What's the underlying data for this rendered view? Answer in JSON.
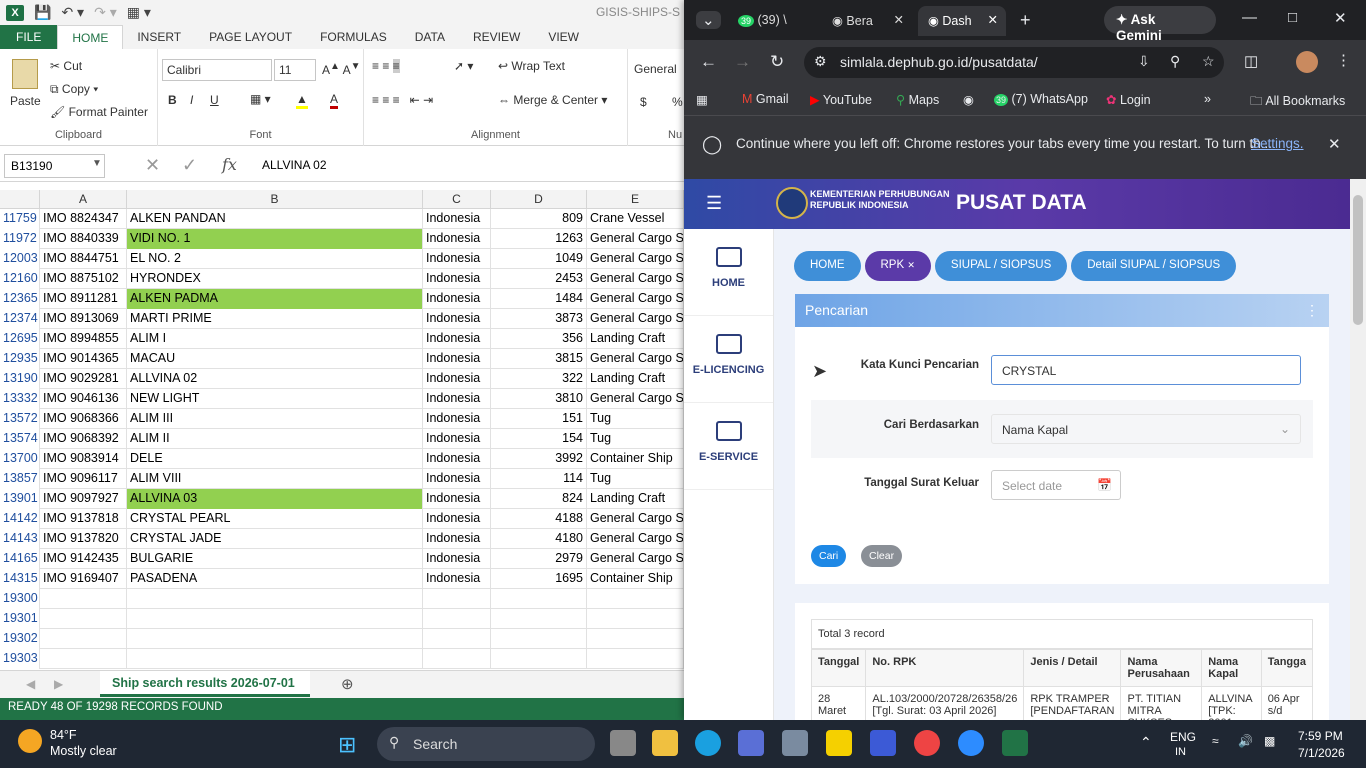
{
  "excel": {
    "doc_title": "GISIS-SHIPS-S",
    "ribbon_tabs": [
      "FILE",
      "HOME",
      "INSERT",
      "PAGE LAYOUT",
      "FORMULAS",
      "DATA",
      "REVIEW",
      "VIEW"
    ],
    "clipboard": {
      "paste": "Paste",
      "cut": "Cut",
      "copy": "Copy",
      "format_painter": "Format Painter",
      "label": "Clipboard"
    },
    "font": {
      "name": "Calibri",
      "size": "11",
      "label": "Font",
      "bold": "B",
      "italic": "I",
      "underline": "U"
    },
    "alignment": {
      "wrap": "Wrap Text",
      "merge": "Merge & Center",
      "label": "Alignment"
    },
    "number": {
      "format": "General",
      "label": "Nu",
      "currency": "$",
      "percent": "%"
    },
    "name_box": "B13190",
    "formula_value": "ALLVINA 02",
    "columns": [
      "A",
      "B",
      "C",
      "D",
      "E"
    ],
    "rows": [
      {
        "n": "11759",
        "a": "IMO 8824347",
        "b": "ALKEN PANDAN",
        "c": "Indonesia",
        "d": "809",
        "e": "Crane Vessel",
        "hl": false
      },
      {
        "n": "11972",
        "a": "IMO 8840339",
        "b": "VIDI NO. 1",
        "c": "Indonesia",
        "d": "1263",
        "e": "General Cargo S",
        "hl": true
      },
      {
        "n": "12003",
        "a": "IMO 8844751",
        "b": "EL NO. 2",
        "c": "Indonesia",
        "d": "1049",
        "e": "General Cargo S",
        "hl": false
      },
      {
        "n": "12160",
        "a": "IMO 8875102",
        "b": "HYRONDEX",
        "c": "Indonesia",
        "d": "2453",
        "e": "General Cargo S",
        "hl": false
      },
      {
        "n": "12365",
        "a": "IMO 8911281",
        "b": "ALKEN PADMA",
        "c": "Indonesia",
        "d": "1484",
        "e": "General Cargo S",
        "hl": true
      },
      {
        "n": "12374",
        "a": "IMO 8913069",
        "b": "MARTI PRIME",
        "c": "Indonesia",
        "d": "3873",
        "e": "General Cargo S",
        "hl": false
      },
      {
        "n": "12695",
        "a": "IMO 8994855",
        "b": "ALIM I",
        "c": "Indonesia",
        "d": "356",
        "e": "Landing Craft",
        "hl": false
      },
      {
        "n": "12935",
        "a": "IMO 9014365",
        "b": "MACAU",
        "c": "Indonesia",
        "d": "3815",
        "e": "General Cargo S",
        "hl": false
      },
      {
        "n": "13190",
        "a": "IMO 9029281",
        "b": "ALLVINA 02",
        "c": "Indonesia",
        "d": "322",
        "e": "Landing Craft",
        "hl": false
      },
      {
        "n": "13332",
        "a": "IMO 9046136",
        "b": "NEW LIGHT",
        "c": "Indonesia",
        "d": "3810",
        "e": "General Cargo S",
        "hl": false
      },
      {
        "n": "13572",
        "a": "IMO 9068366",
        "b": "ALIM III",
        "c": "Indonesia",
        "d": "151",
        "e": "Tug",
        "hl": false
      },
      {
        "n": "13574",
        "a": "IMO 9068392",
        "b": "ALIM II",
        "c": "Indonesia",
        "d": "154",
        "e": "Tug",
        "hl": false
      },
      {
        "n": "13700",
        "a": "IMO 9083914",
        "b": "DELE",
        "c": "Indonesia",
        "d": "3992",
        "e": "Container Ship",
        "hl": false
      },
      {
        "n": "13857",
        "a": "IMO 9096117",
        "b": "ALIM VIII",
        "c": "Indonesia",
        "d": "114",
        "e": "Tug",
        "hl": false
      },
      {
        "n": "13901",
        "a": "IMO 9097927",
        "b": "ALLVINA 03",
        "c": "Indonesia",
        "d": "824",
        "e": "Landing Craft",
        "hl": true
      },
      {
        "n": "14142",
        "a": "IMO 9137818",
        "b": "CRYSTAL PEARL",
        "c": "Indonesia",
        "d": "4188",
        "e": "General Cargo S",
        "hl": false
      },
      {
        "n": "14143",
        "a": "IMO 9137820",
        "b": "CRYSTAL JADE",
        "c": "Indonesia",
        "d": "4180",
        "e": "General Cargo S",
        "hl": false
      },
      {
        "n": "14165",
        "a": "IMO 9142435",
        "b": "BULGARIE",
        "c": "Indonesia",
        "d": "2979",
        "e": "General Cargo S",
        "hl": false
      },
      {
        "n": "14315",
        "a": "IMO 9169407",
        "b": "PASADENA",
        "c": "Indonesia",
        "d": "1695",
        "e": "Container Ship",
        "hl": false
      },
      {
        "n": "19300",
        "a": "",
        "b": "",
        "c": "",
        "d": "",
        "e": "",
        "hl": false
      },
      {
        "n": "19301",
        "a": "",
        "b": "",
        "c": "",
        "d": "",
        "e": "",
        "hl": false
      },
      {
        "n": "19302",
        "a": "",
        "b": "",
        "c": "",
        "d": "",
        "e": "",
        "hl": false
      },
      {
        "n": "19303",
        "a": "",
        "b": "",
        "c": "",
        "d": "",
        "e": "",
        "hl": false
      }
    ],
    "sheet_tab": "Ship search results 2026-07-01",
    "status": "READY    48 OF 19298 RECORDS FOUND",
    "accent": "#217346",
    "highlight": "#92d050"
  },
  "chrome": {
    "tabs": [
      {
        "badge": "39",
        "label": "(39) \\"
      },
      {
        "label": "Bera"
      },
      {
        "label": "Dash"
      }
    ],
    "ask_gemini": "Ask Gemini",
    "url": "simlala.dephub.go.id/pusatdata/",
    "bookmarks": [
      "Gmail",
      "YouTube",
      "Maps",
      "(7) WhatsApp",
      "Login",
      "All Bookmarks"
    ],
    "whatsapp_badge": "39",
    "info_text": "Continue where you left off: Chrome restores your tabs every time you restart. To turn th...",
    "info_link": "Settings."
  },
  "page": {
    "ministry": "KEMENTERIAN PERHUBUNGAN\nREPUBLIK INDONESIA",
    "title": "PUSAT DATA",
    "side": [
      "HOME",
      "E-LICENCING",
      "E-SERVICE"
    ],
    "crumbs": [
      "HOME",
      "RPK",
      "SIUPAL / SIOPSUS",
      "Detail SIUPAL / SIOPSUS"
    ],
    "card_title": "Pencarian",
    "fields": {
      "keyword_label": "Kata Kunci Pencarian",
      "keyword_value": "CRYSTAL",
      "by_label": "Cari Berdasarkan",
      "by_value": "Nama Kapal",
      "date_label": "Tanggal Surat Keluar",
      "date_placeholder": "Select date"
    },
    "btn_search": "Cari",
    "btn_clear": "Clear",
    "total": "Total 3 record",
    "table_headers": [
      "Tanggal",
      "No. RPK",
      "Jenis / Detail",
      "Nama Perusahaan",
      "Nama Kapal",
      "Tangga"
    ],
    "table_row": [
      "28 Maret",
      "AL.103/2000/20728/26358/26 [Tgl. Surat: 03 April 2026]",
      "RPK TRAMPER [PENDAFTARAN",
      "PT. TITIAN MITRA SUKSES",
      "ALLVINA [TPK: 2001",
      "06 Apr s/d"
    ]
  },
  "taskbar": {
    "weather_temp": "84°F",
    "weather_desc": "Mostly clear",
    "search": "Search",
    "lang": "ENG",
    "lang2": "IN",
    "time": "7:59 PM",
    "date": "7/1/2026"
  }
}
